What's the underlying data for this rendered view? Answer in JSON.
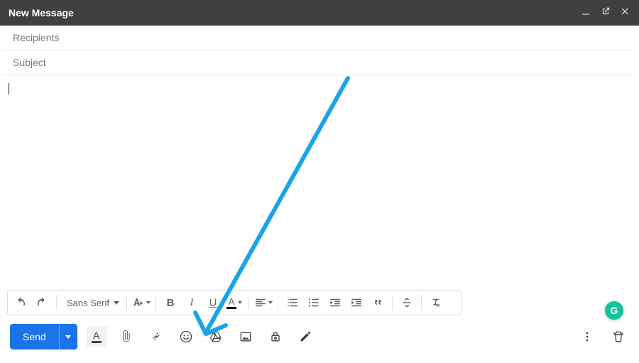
{
  "window": {
    "title": "New Message"
  },
  "fields": {
    "recipients_placeholder": "Recipients",
    "recipients_value": "",
    "subject_placeholder": "Subject",
    "subject_value": ""
  },
  "body": {
    "content": ""
  },
  "format_toolbar": {
    "font_name": "Sans Serif"
  },
  "bottom": {
    "send_label": "Send"
  },
  "grammarly_label": "G",
  "annotation": {
    "stroke": "#1ba3e8"
  }
}
